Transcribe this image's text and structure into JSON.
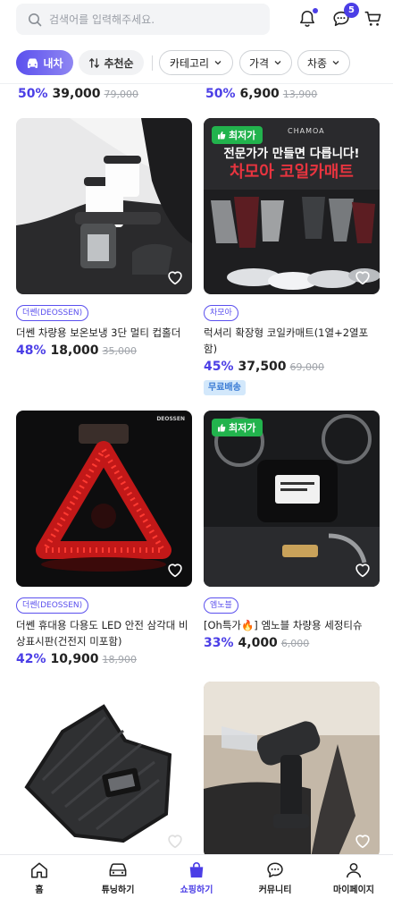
{
  "search": {
    "placeholder": "검색어를 입력해주세요."
  },
  "header": {
    "chat_badge": "5"
  },
  "filters": {
    "car": "내차",
    "sort": "추천순",
    "category": "카테고리",
    "price": "가격",
    "car_type": "차종"
  },
  "partial_row": [
    {
      "discount": "50%",
      "price": "39,000",
      "original": "79,000"
    },
    {
      "discount": "50%",
      "price": "6,900",
      "original": "13,900"
    }
  ],
  "products": [
    {
      "brand": "더쎈(DEOSSEN)",
      "title": "더쎈 차량용 보온보냉 3단 멀티 컵홀더",
      "discount": "48%",
      "price": "18,000",
      "original": "35,000"
    },
    {
      "badge": "최저가",
      "ad_line1": "전문가가 만들면 다릅니다!",
      "ad_line2": "차모아 코일카매트",
      "ad_logo": "CHAMOA",
      "brand": "차모아",
      "title": "럭셔리 확장형 코일카매트(1열+2열포함)",
      "discount": "45%",
      "price": "37,500",
      "original": "69,000",
      "tag": "무료배송"
    },
    {
      "brand": "더쎈(DEOSSEN)",
      "title": "더쎈 휴대용 다용도 LED 안전 삼각대 비상표시판(건전지 미포함)",
      "discount": "42%",
      "price": "10,900",
      "original": "18,900",
      "watermark": "DEOSSEN"
    },
    {
      "badge": "최저가",
      "brand": "엠노블",
      "title": "[Oh특가🔥] 엠노블 차량용 세정티슈",
      "discount": "33%",
      "price": "4,000",
      "original": "6,000"
    },
    {},
    {}
  ],
  "nav": [
    {
      "label": "홈",
      "icon": "home-icon"
    },
    {
      "label": "튜닝하기",
      "icon": "car-icon"
    },
    {
      "label": "쇼핑하기",
      "icon": "shopping-bag-icon",
      "active": true
    },
    {
      "label": "커뮤니티",
      "icon": "chat-bubble-icon"
    },
    {
      "label": "마이페이지",
      "icon": "user-icon"
    }
  ],
  "colors": {
    "accent": "#4b3ee6",
    "badge_green": "#22b34d",
    "free_ship_bg": "#d3e8fb"
  }
}
